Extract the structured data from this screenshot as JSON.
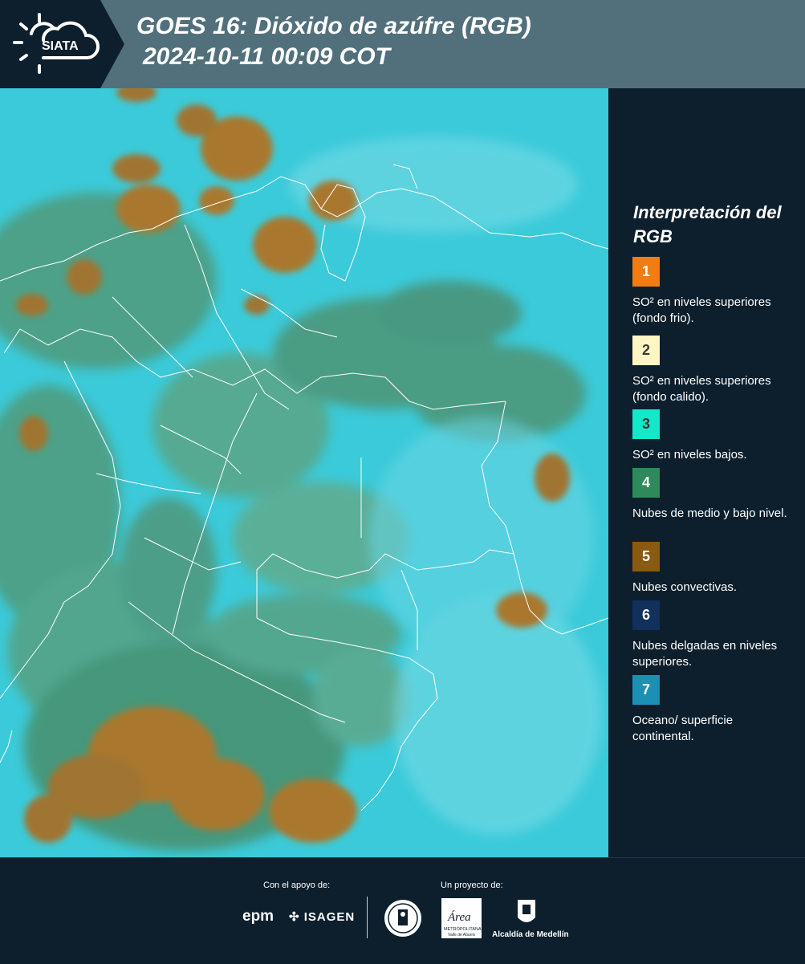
{
  "header": {
    "logo_text": "SIATA",
    "title_line1": "GOES 16: Dióxido de azúfre (RGB)",
    "title_line2": "2024-10-11 00:09 COT"
  },
  "legend": {
    "title": "Interpretación del RGB",
    "items": [
      {
        "number": "1",
        "color": "#f27c12",
        "description": "SO² en niveles superiores (fondo frio)."
      },
      {
        "number": "2",
        "color": "#fff6c4",
        "description": "SO² en niveles superiores (fondo calido)."
      },
      {
        "number": "3",
        "color": "#13e8c8",
        "description": "SO² en niveles bajos."
      },
      {
        "number": "4",
        "color": "#2e8a5a",
        "description": "Nubes de medio y bajo nivel."
      },
      {
        "number": "5",
        "color": "#8a5a10",
        "description": "Nubes convectivas."
      },
      {
        "number": "6",
        "color": "#12305c",
        "description": "Nubes delgadas en niveles superiores."
      },
      {
        "number": "7",
        "color": "#1c8fb5",
        "description": "Oceano/ superficie continental."
      }
    ]
  },
  "footer": {
    "support_label": "Con el apoyo de:",
    "project_label": "Un proyecto de:",
    "sponsor1": "epm",
    "sponsor2": "ISAGEN",
    "partner_area": "Área",
    "partner_area_sub": "METROPOLITANA",
    "partner_area_sub2": "Valle de Aburrá",
    "partner_alcaldia": "Alcaldía de Medellín"
  }
}
